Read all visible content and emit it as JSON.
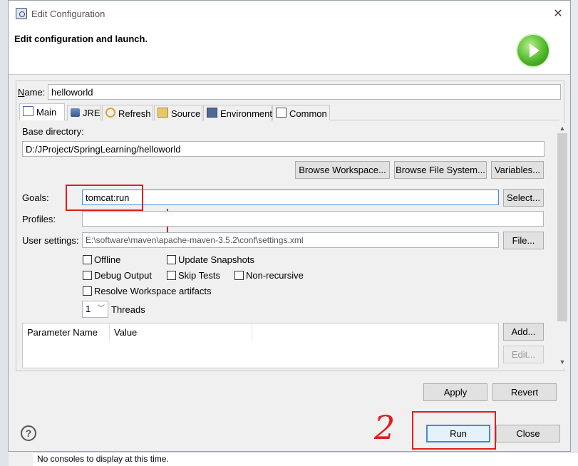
{
  "window": {
    "title": "Edit Configuration",
    "header": "Edit configuration and launch.",
    "close_glyph": "✕"
  },
  "form": {
    "name_label": "Name:",
    "name_value": "helloworld"
  },
  "tabs": [
    {
      "label": "Main",
      "icon": "main-tab-icon"
    },
    {
      "label": "JRE",
      "icon": "jre-tab-icon"
    },
    {
      "label": "Refresh",
      "icon": "refresh-tab-icon"
    },
    {
      "label": "Source",
      "icon": "source-tab-icon"
    },
    {
      "label": "Environment",
      "icon": "environment-tab-icon"
    },
    {
      "label": "Common",
      "icon": "common-tab-icon"
    }
  ],
  "main": {
    "base_dir_label": "Base directory:",
    "base_dir_value": "D:/JProject/SpringLearning/helloworld",
    "browse_workspace": "Browse Workspace...",
    "browse_fs": "Browse File System...",
    "variables": "Variables...",
    "goals_label": "Goals:",
    "goals_value": "tomcat:run",
    "select": "Select...",
    "profiles_label": "Profiles:",
    "profiles_value": "",
    "user_settings_label": "User settings:",
    "user_settings_value": "E:\\software\\maven\\apache-maven-3.5.2\\conf\\settings.xml",
    "file": "File...",
    "offline": "Offline",
    "update_snapshots": "Update Snapshots",
    "debug_output": "Debug Output",
    "skip_tests": "Skip Tests",
    "non_recursive": "Non-recursive",
    "resolve_workspace": "Resolve Workspace artifacts",
    "threads_value": "1",
    "threads_label": "Threads",
    "param_col_name": "Parameter Name",
    "param_col_value": "Value",
    "add": "Add...",
    "edit": "Edit..."
  },
  "footer": {
    "apply": "Apply",
    "revert": "Revert",
    "run": "Run",
    "close": "Close",
    "help_glyph": "?"
  },
  "background": {
    "console_text": "No consoles to display at this time."
  },
  "annotation": {
    "number": "2"
  },
  "colors": {
    "annotation_red": "#e01d1d",
    "focus_blue": "#3c8ddc"
  }
}
